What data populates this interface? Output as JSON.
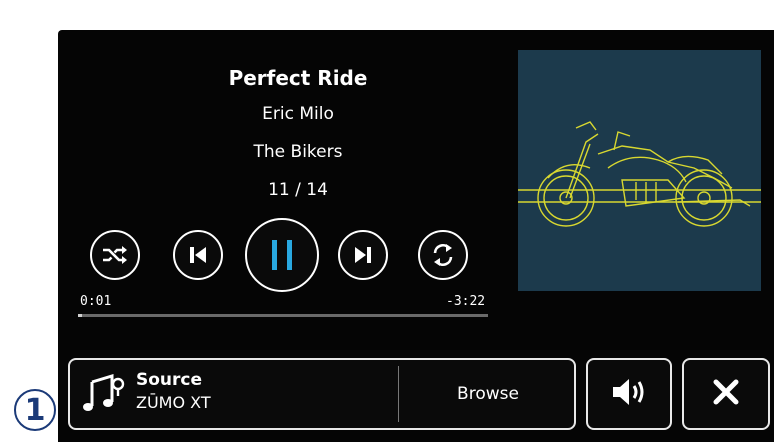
{
  "track": {
    "title": "Perfect Ride",
    "artist": "Eric Milo",
    "album": "The Bikers",
    "position": "11 / 14"
  },
  "playback": {
    "elapsed": "0:01",
    "remaining": "-3:22",
    "progress_fraction": 0.01
  },
  "controls": {
    "shuffle": {
      "icon": "shuffle-icon"
    },
    "previous": {
      "icon": "skip-previous-icon"
    },
    "pause": {
      "icon": "pause-icon"
    },
    "next": {
      "icon": "skip-next-icon"
    },
    "repeat": {
      "icon": "repeat-icon"
    }
  },
  "source": {
    "label": "Source",
    "value": "ZŪMO XT",
    "icon": "music-note-icon"
  },
  "browse_label": "Browse",
  "volume": {
    "icon": "speaker-volume-icon"
  },
  "close": {
    "icon": "close-icon"
  },
  "callout": "1",
  "album_art": {
    "icon": "motorcycle-icon"
  },
  "colors": {
    "screen_bg": "#050505",
    "accent": "#29a8e0",
    "art_bg": "#1c3a4c",
    "art_line": "#d8d830",
    "callout": "#1b3a78"
  }
}
